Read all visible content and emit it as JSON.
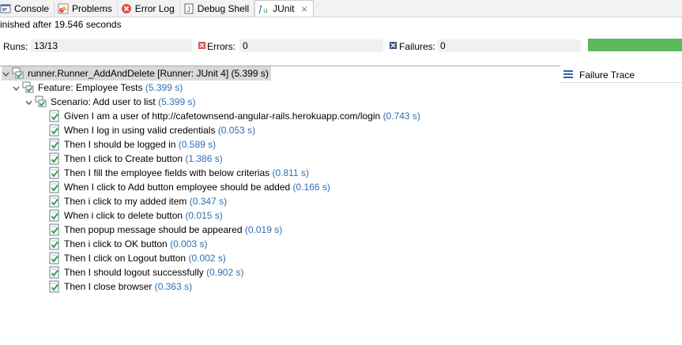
{
  "tabs": [
    {
      "label": "Console",
      "icon": "console-icon",
      "active": false
    },
    {
      "label": "Problems",
      "icon": "problems-icon",
      "active": false
    },
    {
      "label": "Error Log",
      "icon": "error-log-icon",
      "active": false
    },
    {
      "label": "Debug Shell",
      "icon": "debug-shell-icon",
      "active": false
    },
    {
      "label": "JUnit",
      "icon": "junit-icon",
      "active": true
    }
  ],
  "close_glyph": "⨯",
  "status_text": "inished after 19.546 seconds",
  "counters": {
    "runs_label": "Runs:",
    "runs_value": "13/13",
    "errors_label": "Errors:",
    "errors_value": "0",
    "failures_label": "Failures:",
    "failures_value": "0"
  },
  "progress": {
    "fraction": 1.0,
    "color": "#5cb85c"
  },
  "failure_trace": {
    "label": "Failure Trace"
  },
  "tree": {
    "root": {
      "label": "runner.Runner_AddAndDelete [Runner: JUnit 4] (5.399 s)"
    },
    "feature": {
      "label": "Feature: Employee Tests",
      "duration": "(5.399 s)"
    },
    "scenario": {
      "label": "Scenario: Add user to list",
      "duration": "(5.399 s)"
    },
    "steps": [
      {
        "label": "Given I am a user of http://cafetownsend-angular-rails.herokuapp.com/login",
        "duration": "(0.743 s)"
      },
      {
        "label": "When I log in using valid credentials",
        "duration": "(0.053 s)"
      },
      {
        "label": "Then I should be logged in",
        "duration": "(0.589 s)"
      },
      {
        "label": "Then I click to Create button",
        "duration": "(1.386 s)"
      },
      {
        "label": "Then I fill the employee fields with below criterias",
        "duration": "(0.811 s)"
      },
      {
        "label": "When I click to Add button employee should be added",
        "duration": "(0.166 s)"
      },
      {
        "label": "Then i click to my added item",
        "duration": "(0.347 s)"
      },
      {
        "label": "When i click to delete button",
        "duration": "(0.015 s)"
      },
      {
        "label": "Then popup message should be appeared",
        "duration": "(0.019 s)"
      },
      {
        "label": "Then i click to OK button",
        "duration": "(0.003 s)"
      },
      {
        "label": "Then I click on Logout button",
        "duration": "(0.002 s)"
      },
      {
        "label": "Then I should logout successfully",
        "duration": "(0.902 s)"
      },
      {
        "label": "Then I close browser",
        "duration": "(0.363 s)"
      }
    ]
  },
  "colors": {
    "duration": "#2f6fae",
    "pass_check": "#2e9e3a",
    "error_mark": "#d9534f",
    "failure_mark": "#3a4f7a"
  }
}
